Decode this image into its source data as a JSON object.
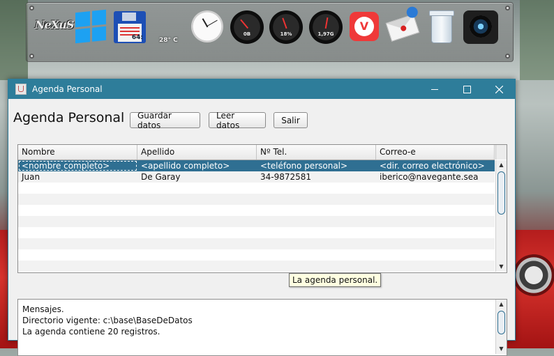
{
  "desktop": {
    "dock": {
      "app_logo": "NeXuS",
      "floppy_label": "64:",
      "temperature": "28° C",
      "gauges": [
        {
          "value": "0B"
        },
        {
          "value": "18%"
        },
        {
          "value": "1,97G"
        }
      ]
    }
  },
  "window": {
    "title": "Agenda Personal",
    "heading": "Agenda Personal",
    "toolbar": {
      "save_label": "Guardar datos",
      "load_label": "Leer datos",
      "exit_label": "Salir"
    },
    "table": {
      "columns": [
        "Nombre",
        "Apellido",
        "Nº Tel.",
        "Correo-e"
      ],
      "rows": [
        [
          "<nombre completo>",
          "<apellido completo>",
          "<teléfono personal>",
          "<dir. correo electrónico>"
        ],
        [
          "Juan",
          "De Garay",
          "34-9872581",
          "iberico@navegante.sea"
        ]
      ],
      "selected_row": 0
    },
    "tooltip": "La agenda personal.",
    "messages": [
      "Mensajes.",
      "Directorio vigente: c:\\base\\BaseDeDatos",
      "La agenda contiene 20 registros."
    ]
  }
}
